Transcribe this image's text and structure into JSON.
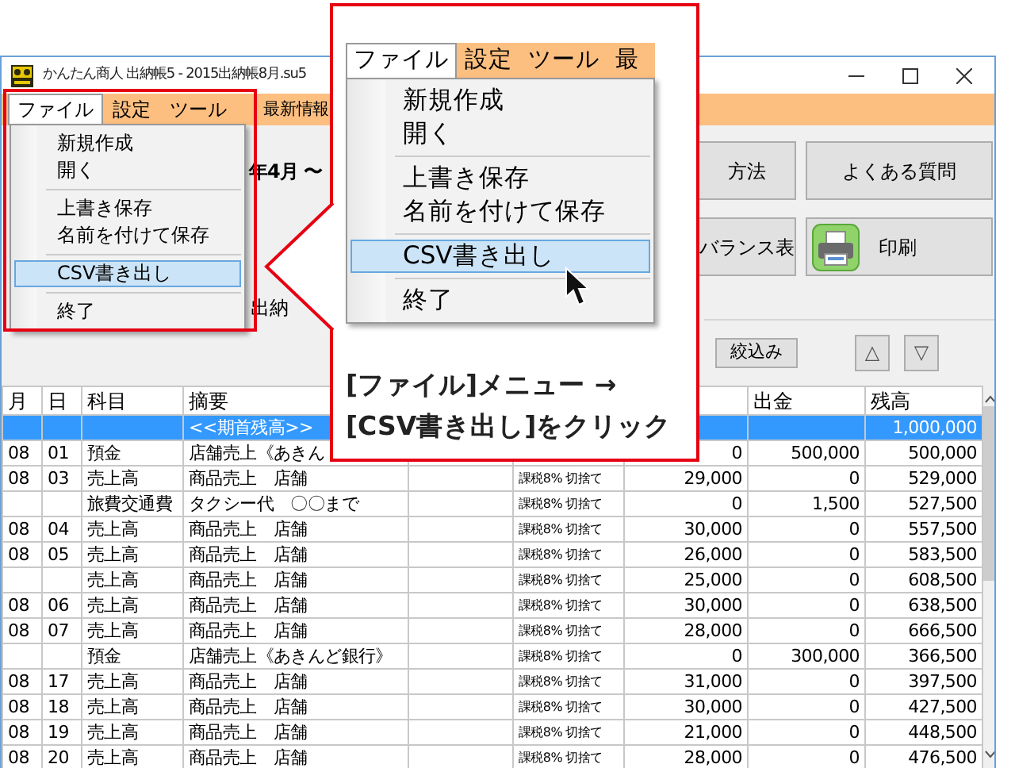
{
  "window": {
    "title": "かんたん商人 出納帳5 - 2015出納帳8月.su5"
  },
  "menu_bar": [
    {
      "label": "ファイル",
      "selected": true
    },
    {
      "label": "設定",
      "selected": false
    },
    {
      "label": "ツール",
      "selected": false
    },
    {
      "label": "最新情報",
      "selected": false
    }
  ],
  "file_menu": [
    {
      "kind": "item",
      "label": "新規作成",
      "selected": false
    },
    {
      "kind": "item",
      "label": "開く",
      "selected": false
    },
    {
      "kind": "separator"
    },
    {
      "kind": "item",
      "label": "上書き保存",
      "selected": false
    },
    {
      "kind": "item",
      "label": "名前を付けて保存",
      "selected": false
    },
    {
      "kind": "separator"
    },
    {
      "kind": "item",
      "label": "CSV書き出し",
      "selected": true
    },
    {
      "kind": "separator"
    },
    {
      "kind": "item",
      "label": "終了",
      "selected": false
    }
  ],
  "toolbar": {
    "period_text": "年4月 〜",
    "filter_label": "出納",
    "buttons_row_1": [
      {
        "label": "方法"
      },
      {
        "label": "よくある質問"
      }
    ],
    "buttons_row_2": [
      {
        "label": "バランス表"
      },
      {
        "label": "印刷",
        "kind": "print"
      }
    ],
    "filter_button": "絞込み",
    "up_button": "△",
    "down_button": "▽"
  },
  "table": {
    "columns": [
      {
        "label": "月"
      },
      {
        "label": "日"
      },
      {
        "label": "科目"
      },
      {
        "label": "摘要"
      },
      {},
      {},
      {},
      {
        "label": "出金"
      },
      {
        "label": "残高"
      }
    ],
    "rows": [
      {
        "selected": true,
        "cells": [
          null,
          null,
          null,
          "<<期首残高>>",
          null,
          null,
          null,
          null,
          "1,000,000"
        ]
      },
      {
        "selected": false,
        "cells": [
          "08",
          "01",
          "預金",
          "店舗売上《あきん",
          null,
          null,
          "0",
          "500,000",
          "500,000"
        ]
      },
      {
        "selected": false,
        "cells": [
          "08",
          "03",
          "売上高",
          "商品売上　店舗",
          null,
          "課税8% 切捨て",
          "29,000",
          "0",
          "529,000"
        ]
      },
      {
        "selected": false,
        "cells": [
          null,
          null,
          "旅費交通費",
          "タクシー代　〇〇まで",
          null,
          "課税8% 切捨て",
          "0",
          "1,500",
          "527,500"
        ]
      },
      {
        "selected": false,
        "cells": [
          "08",
          "04",
          "売上高",
          "商品売上　店舗",
          null,
          "課税8% 切捨て",
          "30,000",
          "0",
          "557,500"
        ]
      },
      {
        "selected": false,
        "cells": [
          "08",
          "05",
          "売上高",
          "商品売上　店舗",
          null,
          "課税8% 切捨て",
          "26,000",
          "0",
          "583,500"
        ]
      },
      {
        "selected": false,
        "cells": [
          null,
          null,
          "売上高",
          "商品売上　店舗",
          null,
          "課税8% 切捨て",
          "25,000",
          "0",
          "608,500"
        ]
      },
      {
        "selected": false,
        "cells": [
          "08",
          "06",
          "売上高",
          "商品売上　店舗",
          null,
          "課税8% 切捨て",
          "30,000",
          "0",
          "638,500"
        ]
      },
      {
        "selected": false,
        "cells": [
          "08",
          "07",
          "売上高",
          "商品売上　店舗",
          null,
          "課税8% 切捨て",
          "28,000",
          "0",
          "666,500"
        ]
      },
      {
        "selected": false,
        "cells": [
          null,
          null,
          "預金",
          "店舗売上《あきんど銀行》",
          null,
          "課税8% 切捨て",
          "0",
          "300,000",
          "366,500"
        ]
      },
      {
        "selected": false,
        "cells": [
          "08",
          "17",
          "売上高",
          "商品売上　店舗",
          null,
          "課税8% 切捨て",
          "31,000",
          "0",
          "397,500"
        ]
      },
      {
        "selected": false,
        "cells": [
          "08",
          "18",
          "売上高",
          "商品売上　店舗",
          null,
          "課税8% 切捨て",
          "30,000",
          "0",
          "427,500"
        ]
      },
      {
        "selected": false,
        "cells": [
          "08",
          "19",
          "売上高",
          "商品売上　店舗",
          null,
          "課税8% 切捨て",
          "21,000",
          "0",
          "448,500"
        ]
      },
      {
        "selected": false,
        "cells": [
          "08",
          "20",
          "売上高",
          "商品売上　店舗",
          null,
          "課税8% 切捨て",
          "28,000",
          "0",
          "476,500"
        ]
      }
    ]
  },
  "callout": {
    "menu_bar": [
      {
        "label": "ファイル",
        "selected": true
      },
      {
        "label": "設定",
        "selected": false
      },
      {
        "label": "ツール",
        "selected": false
      },
      {
        "label": "最",
        "selected": false
      }
    ],
    "menu_items": [
      {
        "kind": "item",
        "label": "新規作成",
        "selected": false
      },
      {
        "kind": "item",
        "label": "開く",
        "selected": false
      },
      {
        "kind": "separator"
      },
      {
        "kind": "item",
        "label": "上書き保存",
        "selected": false
      },
      {
        "kind": "item",
        "label": "名前を付けて保存",
        "selected": false
      },
      {
        "kind": "separator"
      },
      {
        "kind": "item",
        "label": "CSV書き出し",
        "selected": true
      },
      {
        "kind": "separator"
      },
      {
        "kind": "item",
        "label": "終了",
        "selected": false
      }
    ],
    "caption_lines": [
      "[ファイル]メニュー →",
      "[CSV書き出し]をクリック"
    ]
  }
}
